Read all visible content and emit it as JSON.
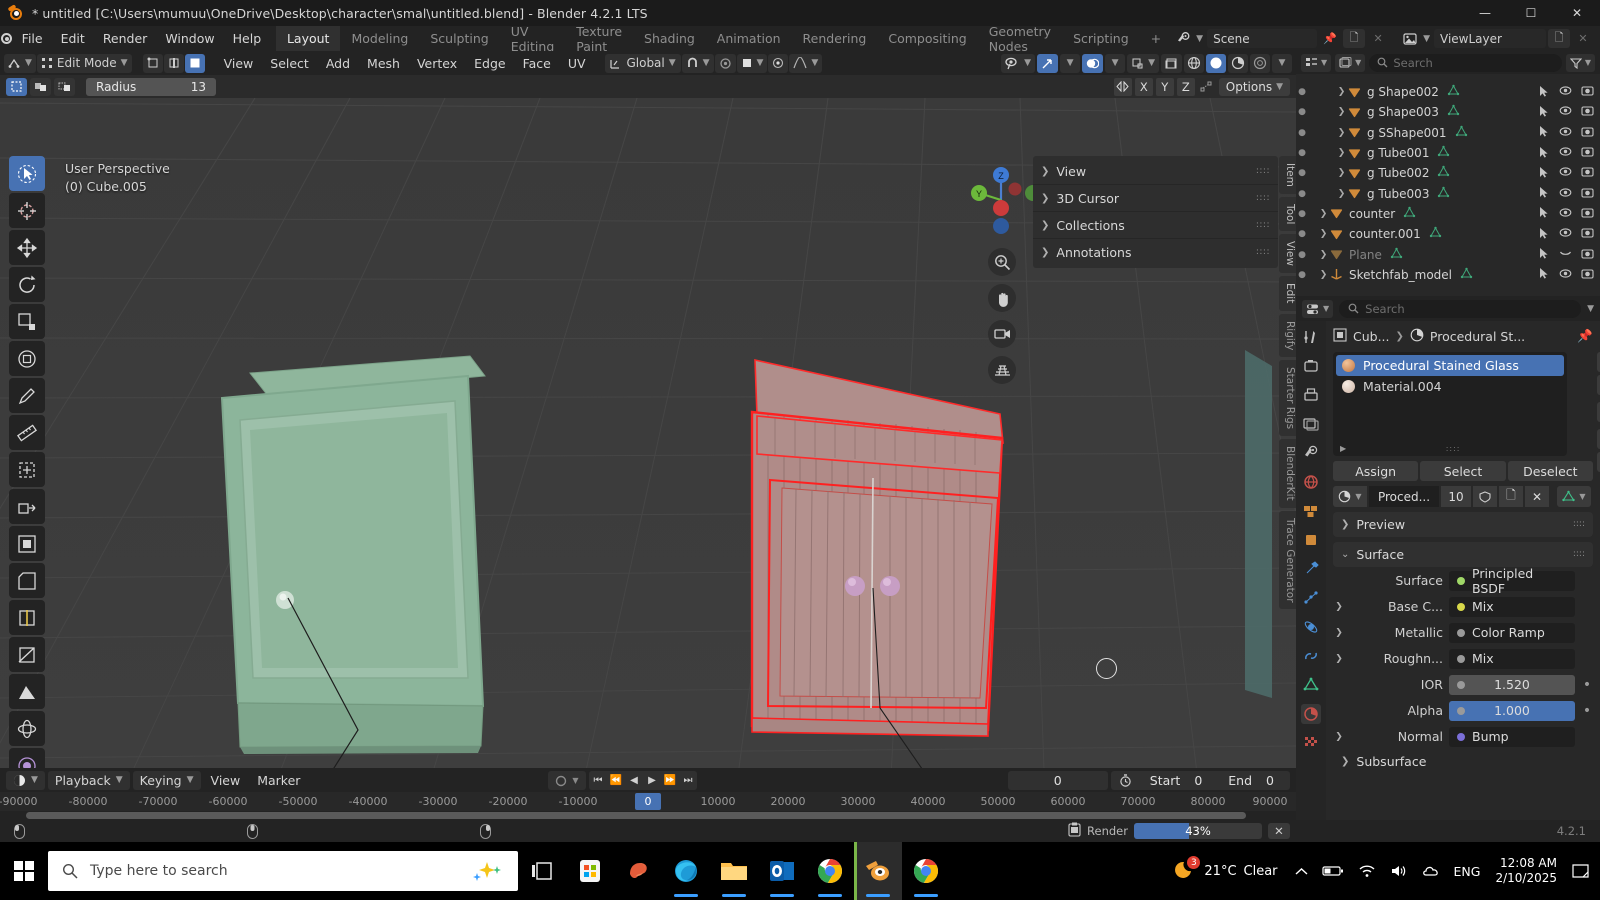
{
  "window": {
    "title": "* untitled [C:\\Users\\mumuu\\OneDrive\\Desktop\\character\\smal\\untitled.blend] - Blender 4.2.1 LTS",
    "minimize": "—",
    "maximize": "☐",
    "close": "✕"
  },
  "topbar": {
    "menus": [
      "File",
      "Edit",
      "Render",
      "Window",
      "Help"
    ],
    "workspaces": [
      {
        "label": "Layout",
        "active": true
      },
      {
        "label": "Modeling",
        "active": false
      },
      {
        "label": "Sculpting",
        "active": false
      },
      {
        "label": "UV Editing",
        "active": false
      },
      {
        "label": "Texture Paint",
        "active": false
      },
      {
        "label": "Shading",
        "active": false
      },
      {
        "label": "Animation",
        "active": false
      },
      {
        "label": "Rendering",
        "active": false
      },
      {
        "label": "Compositing",
        "active": false
      },
      {
        "label": "Geometry Nodes",
        "active": false
      },
      {
        "label": "Scripting",
        "active": false
      },
      {
        "label": "+",
        "active": false
      }
    ],
    "scene_name": "Scene",
    "viewlayer_name": "ViewLayer"
  },
  "viewport": {
    "mode": "Edit Mode",
    "menus": [
      "View",
      "Select",
      "Add",
      "Mesh",
      "Vertex",
      "Edge",
      "Face",
      "UV"
    ],
    "transform_orientation": "Global",
    "radius_label": "Radius",
    "radius_value": "13",
    "axis_buttons": [
      "X",
      "Y",
      "Z"
    ],
    "options_label": "Options",
    "overlay_line1": "User Perspective",
    "overlay_line2": "(0) Cube.005",
    "gizmo_axes": [
      "X",
      "Y",
      "Z"
    ],
    "npanel_items": [
      "View",
      "3D Cursor",
      "Collections",
      "Annotations"
    ],
    "ntabs": [
      "Item",
      "Tool",
      "View",
      "Edit",
      "Rigify",
      "Starter Rigs",
      "BlenderKit",
      "Trace Generator"
    ]
  },
  "outliner": {
    "search_placeholder": "Search",
    "rows": [
      {
        "name": "g Shape002",
        "indent": 3,
        "type": "mesh",
        "dim": false,
        "arrow": true
      },
      {
        "name": "g Shape003",
        "indent": 3,
        "type": "mesh",
        "dim": false,
        "arrow": true
      },
      {
        "name": "g SShape001",
        "indent": 3,
        "type": "mesh",
        "dim": false,
        "arrow": true
      },
      {
        "name": "g Tube001",
        "indent": 3,
        "type": "mesh",
        "dim": false,
        "arrow": true
      },
      {
        "name": "g Tube002",
        "indent": 3,
        "type": "mesh",
        "dim": false,
        "arrow": true
      },
      {
        "name": "g Tube003",
        "indent": 3,
        "type": "mesh",
        "dim": false,
        "arrow": true
      },
      {
        "name": "counter",
        "indent": 1,
        "type": "mesh",
        "dim": false,
        "arrow": true
      },
      {
        "name": "counter.001",
        "indent": 1,
        "type": "mesh",
        "dim": false,
        "arrow": true
      },
      {
        "name": "Plane",
        "indent": 1,
        "type": "mesh",
        "dim": true,
        "arrow": true
      },
      {
        "name": "Sketchfab_model",
        "indent": 1,
        "type": "empty",
        "dim": false,
        "arrow": true
      }
    ]
  },
  "properties": {
    "search_placeholder": "Search",
    "breadcrumb_object": "Cub...",
    "breadcrumb_material": "Procedural St...",
    "materials": [
      {
        "name": "Procedural Stained Glass",
        "selected": true,
        "color": "#d79a6a"
      },
      {
        "name": "Material.004",
        "selected": false,
        "color": "#e3c8b4"
      }
    ],
    "assign_label": "Assign",
    "select_label": "Select",
    "deselect_label": "Deselect",
    "material_name": "Proced...",
    "material_users": "10",
    "preview_label": "Preview",
    "surface_label": "Surface",
    "subsurface_label": "Subsurface",
    "rows": [
      {
        "label": "Surface",
        "value": "Principled BSDF",
        "sock": "#a0d868",
        "arrow": false,
        "kind": "node"
      },
      {
        "label": "Base C...",
        "value": "Mix",
        "sock": "#d8d84a",
        "arrow": true,
        "kind": "node"
      },
      {
        "label": "Metallic",
        "value": "Color Ramp",
        "sock": "#9a9a9a",
        "arrow": true,
        "kind": "node"
      },
      {
        "label": "Roughn...",
        "value": "Mix",
        "sock": "#9a9a9a",
        "arrow": true,
        "kind": "node"
      },
      {
        "label": "IOR",
        "value": "1.520",
        "sock": "#9a9a9a",
        "arrow": false,
        "kind": "num"
      },
      {
        "label": "Alpha",
        "value": "1.000",
        "sock": "#9a9a9a",
        "arrow": false,
        "kind": "blue"
      },
      {
        "label": "Normal",
        "value": "Bump",
        "sock": "#7b6fd8",
        "arrow": true,
        "kind": "node"
      }
    ]
  },
  "timeline": {
    "menus": [
      "View",
      "Marker"
    ],
    "playback_label": "Playback",
    "keying_label": "Keying",
    "current_frame": "0",
    "start_label": "Start",
    "start_value": "0",
    "end_label": "End",
    "end_value": "0",
    "playhead_frame": "0",
    "ruler_ticks": [
      "-90000",
      "-80000",
      "-70000",
      "-60000",
      "-50000",
      "-40000",
      "-30000",
      "-20000",
      "-10000",
      "10000",
      "20000",
      "30000",
      "40000",
      "50000",
      "60000",
      "70000",
      "80000",
      "90000"
    ]
  },
  "statusbar": {
    "render_label": "Render",
    "progress_text": "43%",
    "progress_percent": 43,
    "version": "4.2.1"
  },
  "taskbar": {
    "search_placeholder": "Type here to search",
    "weather_temp": "21°C",
    "weather_desc": "Clear",
    "badge_count": "3",
    "language": "ENG",
    "time": "12:08 AM",
    "date": "2/10/2025"
  }
}
